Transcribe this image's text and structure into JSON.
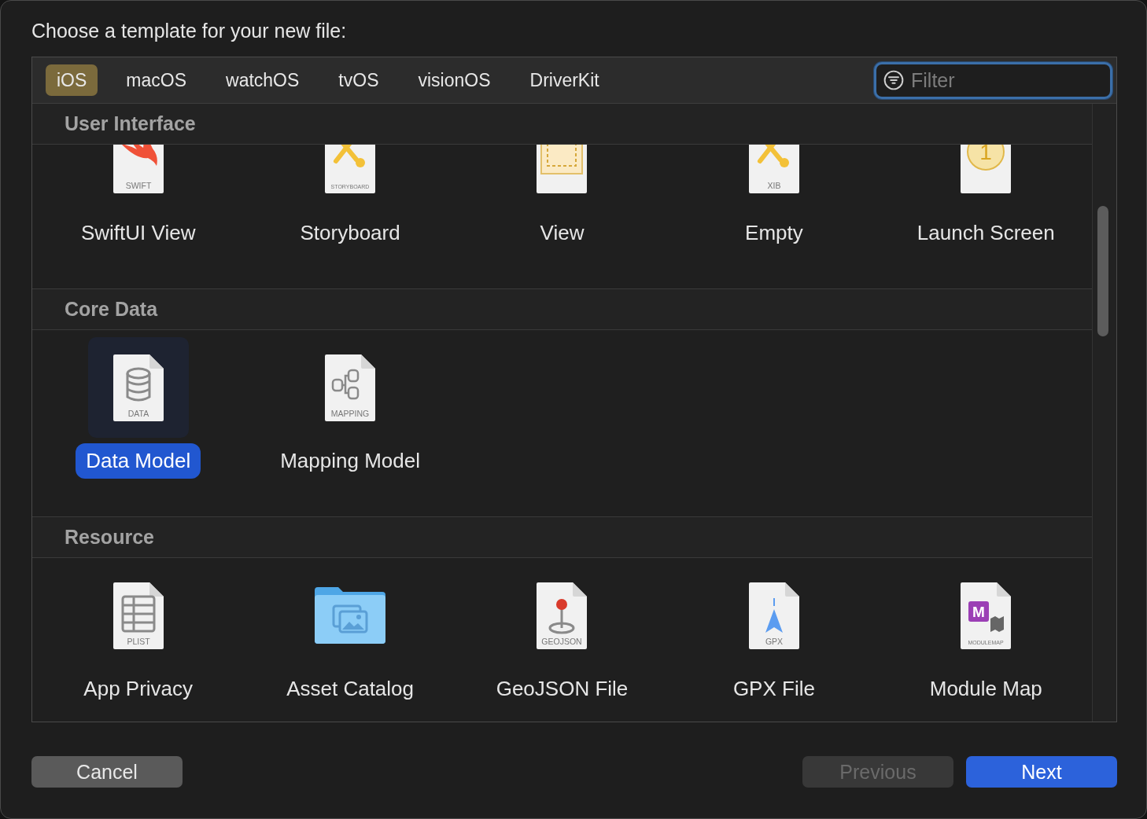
{
  "dialog": {
    "title": "Choose a template for your new file:"
  },
  "tabs": [
    {
      "label": "iOS",
      "selected": true
    },
    {
      "label": "macOS",
      "selected": false
    },
    {
      "label": "watchOS",
      "selected": false
    },
    {
      "label": "tvOS",
      "selected": false
    },
    {
      "label": "visionOS",
      "selected": false
    },
    {
      "label": "DriverKit",
      "selected": false
    }
  ],
  "filter": {
    "placeholder": "Filter"
  },
  "sections": [
    {
      "title": "User Interface",
      "items": [
        {
          "label": "SwiftUI View",
          "kind": "swift",
          "tag": "SWIFT",
          "selected": false
        },
        {
          "label": "Storyboard",
          "kind": "storyboard",
          "tag": "STORYBOARD",
          "selected": false
        },
        {
          "label": "View",
          "kind": "view",
          "selected": false
        },
        {
          "label": "Empty",
          "kind": "xib",
          "tag": "XIB",
          "selected": false
        },
        {
          "label": "Launch Screen",
          "kind": "launch",
          "glyph_text": "1",
          "selected": false
        }
      ]
    },
    {
      "title": "Core Data",
      "items": [
        {
          "label": "Data Model",
          "kind": "data",
          "tag": "DATA",
          "selected": true
        },
        {
          "label": "Mapping Model",
          "kind": "mapping",
          "tag": "MAPPING",
          "selected": false
        }
      ]
    },
    {
      "title": "Resource",
      "items": [
        {
          "label": "App Privacy",
          "kind": "plist",
          "tag": "PLIST",
          "selected": false
        },
        {
          "label": "Asset Catalog",
          "kind": "folder",
          "selected": false
        },
        {
          "label": "GeoJSON File",
          "kind": "geojson",
          "tag": "GEOJSON",
          "selected": false
        },
        {
          "label": "GPX File",
          "kind": "gpx",
          "tag": "GPX",
          "selected": false
        },
        {
          "label": "Module Map",
          "kind": "modulemap",
          "tag": "MODULEMAP",
          "glyph_text": "M",
          "selected": false
        }
      ]
    }
  ],
  "buttons": [
    {
      "label": "Cancel",
      "kind": "secondary",
      "disabled": false
    },
    {
      "label": "Previous",
      "kind": "secondary",
      "disabled": true
    },
    {
      "label": "Next",
      "kind": "primary",
      "disabled": false
    }
  ]
}
